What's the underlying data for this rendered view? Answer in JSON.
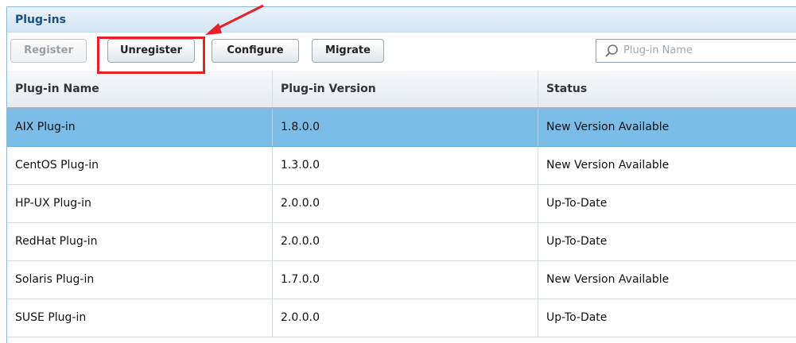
{
  "panel": {
    "title": "Plug-ins"
  },
  "toolbar": {
    "register_label": "Register",
    "unregister_label": "Unregister",
    "configure_label": "Configure",
    "migrate_label": "Migrate",
    "search_placeholder": "Plug-in Name"
  },
  "table": {
    "columns": [
      "Plug-in Name",
      "Plug-in Version",
      "Status"
    ],
    "rows": [
      {
        "name": "AIX Plug-in",
        "version": "1.8.0.0",
        "status": "New Version Available",
        "selected": true
      },
      {
        "name": "CentOS Plug-in",
        "version": "1.3.0.0",
        "status": "New Version Available",
        "selected": false
      },
      {
        "name": "HP-UX Plug-in",
        "version": "2.0.0.0",
        "status": "Up-To-Date",
        "selected": false
      },
      {
        "name": "RedHat Plug-in",
        "version": "2.0.0.0",
        "status": "Up-To-Date",
        "selected": false
      },
      {
        "name": "Solaris Plug-in",
        "version": "1.7.0.0",
        "status": "New Version Available",
        "selected": false
      },
      {
        "name": "SUSE Plug-in",
        "version": "2.0.0.0",
        "status": "Up-To-Date",
        "selected": false
      }
    ]
  },
  "colors": {
    "selection": "#7cbde8",
    "annotation": "#e8202a",
    "title_text": "#1a4f86"
  }
}
